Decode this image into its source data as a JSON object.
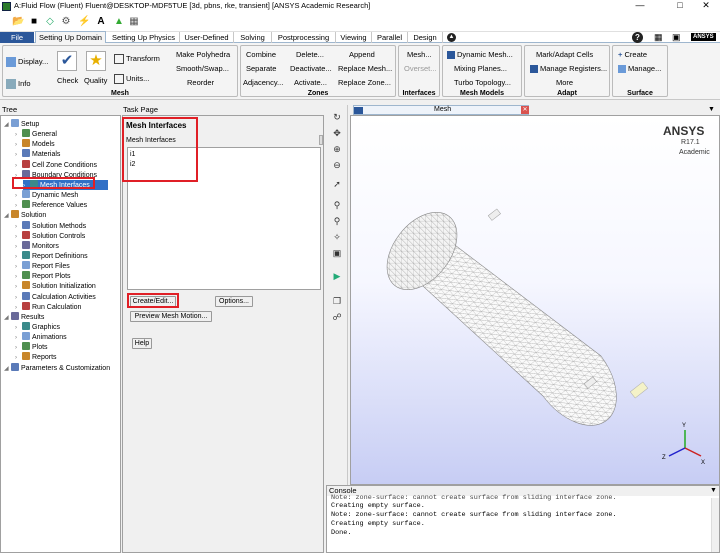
{
  "window": {
    "title": "A:Fluid Flow (Fluent) Fluent@DESKTOP-MDF5TUE  [3d, pbns, rke, transient] [ANSYS Academic Research]",
    "minimize": "—",
    "maximize": "□",
    "close": "✕"
  },
  "tabs": [
    {
      "label": "File"
    },
    {
      "label": "Setting Up Domain"
    },
    {
      "label": "Setting Up Physics"
    },
    {
      "label": "User-Defined"
    },
    {
      "label": "Solving"
    },
    {
      "label": "Postprocessing"
    },
    {
      "label": "Viewing"
    },
    {
      "label": "Parallel"
    },
    {
      "label": "Design"
    }
  ],
  "ribbon": {
    "mesh": {
      "display": "Display...",
      "info": "Info",
      "check": "Check",
      "quality": "Quality",
      "transform": "Transform",
      "units": "Units...",
      "make_polyhedra": "Make Polyhedra",
      "smooth_swap": "Smooth/Swap...",
      "reorder": "Reorder",
      "group": "Mesh"
    },
    "zones": {
      "combine": "Combine",
      "delete": "Delete...",
      "append": "Append",
      "separate": "Separate",
      "deactivate": "Deactivate...",
      "replace_mesh": "Replace Mesh...",
      "adjacency": "Adjacency...",
      "activate": "Activate...",
      "replace_zone": "Replace Zone...",
      "group": "Zones"
    },
    "interfaces": {
      "mesh": "Mesh...",
      "overset": "Overset...",
      "group": "Interfaces"
    },
    "mesh_models": {
      "dynamic_mesh": "Dynamic Mesh...",
      "mixing_planes": "Mixing Planes...",
      "turbo_topology": "Turbo Topology...",
      "group": "Mesh Models"
    },
    "adapt": {
      "mark_adapt": "Mark/Adapt Cells",
      "manage_registers": "Manage Registers...",
      "more": "More",
      "group": "Adapt"
    },
    "surface": {
      "create": "Create",
      "manage": "Manage...",
      "group": "Surface"
    },
    "help_icon": "?",
    "ansys_logo": "ANSYS"
  },
  "tree": {
    "header": "Tree",
    "items": [
      {
        "label": "Setup",
        "level": 0
      },
      {
        "label": "General",
        "level": 1
      },
      {
        "label": "Models",
        "level": 1
      },
      {
        "label": "Materials",
        "level": 1
      },
      {
        "label": "Cell Zone Conditions",
        "level": 1
      },
      {
        "label": "Boundary Conditions",
        "level": 1
      },
      {
        "label": "Mesh Interfaces",
        "level": 1,
        "selected": true
      },
      {
        "label": "Dynamic Mesh",
        "level": 1
      },
      {
        "label": "Reference Values",
        "level": 1
      },
      {
        "label": "Solution",
        "level": 0
      },
      {
        "label": "Solution Methods",
        "level": 1
      },
      {
        "label": "Solution Controls",
        "level": 1
      },
      {
        "label": "Monitors",
        "level": 1
      },
      {
        "label": "Report Definitions",
        "level": 1
      },
      {
        "label": "Report Files",
        "level": 1
      },
      {
        "label": "Report Plots",
        "level": 1
      },
      {
        "label": "Solution Initialization",
        "level": 1
      },
      {
        "label": "Calculation Activities",
        "level": 1
      },
      {
        "label": "Run Calculation",
        "level": 1
      },
      {
        "label": "Results",
        "level": 0
      },
      {
        "label": "Graphics",
        "level": 1
      },
      {
        "label": "Animations",
        "level": 1
      },
      {
        "label": "Plots",
        "level": 1
      },
      {
        "label": "Reports",
        "level": 1
      },
      {
        "label": "Parameters & Customization",
        "level": 0
      }
    ]
  },
  "task": {
    "header": "Task Page",
    "title": "Mesh Interfaces",
    "list_label": "Mesh Interfaces",
    "interfaces": [
      "i1",
      "i2"
    ],
    "create_edit": "Create/Edit...",
    "options": "Options...",
    "preview": "Preview Mesh Motion...",
    "help": "Help"
  },
  "graphics": {
    "tab_label": "Mesh",
    "brand": "ANSYS",
    "version": "R17.1",
    "edition": "Academic"
  },
  "console": {
    "header": "Console",
    "lines": [
      "Note: zone-surface: cannot create surface from sliding interface zone.",
      "Creating empty surface.",
      "Note: zone-surface: cannot create surface from sliding interface zone.",
      "Creating empty surface.",
      "        Done."
    ]
  },
  "colors": {
    "accent": "#2b579a",
    "highlight": "#e01f26",
    "selection": "#3170c6"
  }
}
